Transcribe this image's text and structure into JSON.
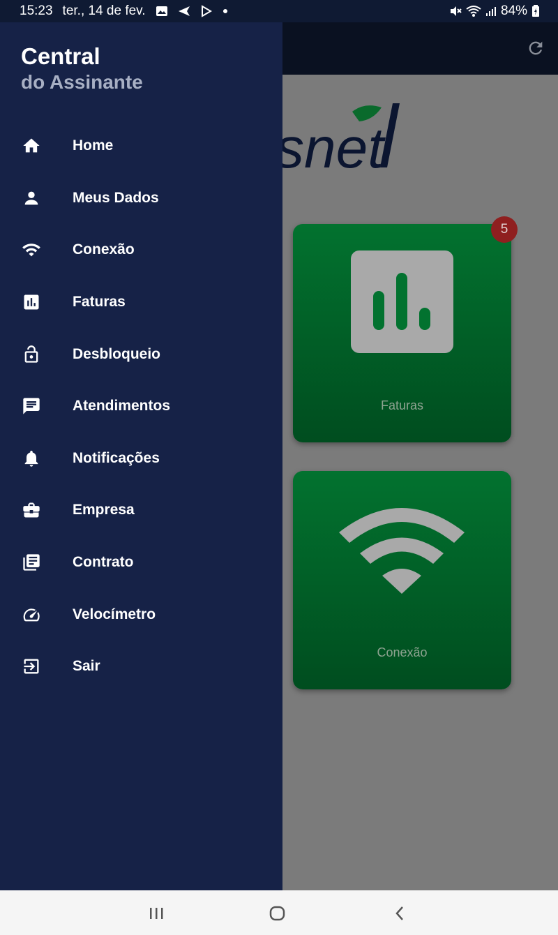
{
  "status_bar": {
    "time": "15:23",
    "date": "ter., 14 de fev.",
    "battery": "84%"
  },
  "drawer": {
    "title": "Central",
    "subtitle": "do Assinante",
    "items": [
      {
        "label": "Home",
        "icon": "home-icon"
      },
      {
        "label": "Meus Dados",
        "icon": "person-icon"
      },
      {
        "label": "Conexão",
        "icon": "wifi-icon"
      },
      {
        "label": "Faturas",
        "icon": "bar-chart-icon"
      },
      {
        "label": "Desbloqueio",
        "icon": "lock-open-icon"
      },
      {
        "label": "Atendimentos",
        "icon": "chat-icon"
      },
      {
        "label": "Notificações",
        "icon": "bell-icon"
      },
      {
        "label": "Empresa",
        "icon": "briefcase-icon"
      },
      {
        "label": "Contrato",
        "icon": "document-icon"
      },
      {
        "label": "Velocímetro",
        "icon": "speedometer-icon"
      },
      {
        "label": "Sair",
        "icon": "logout-icon"
      }
    ]
  },
  "main": {
    "logo_text": "snet",
    "tiles": [
      {
        "label": "Faturas",
        "badge": "5"
      },
      {
        "label": "Conexão"
      }
    ]
  },
  "colors": {
    "drawer_bg": "#162247",
    "tile_green": "#02722f",
    "badge_red": "#8f1f1f"
  }
}
